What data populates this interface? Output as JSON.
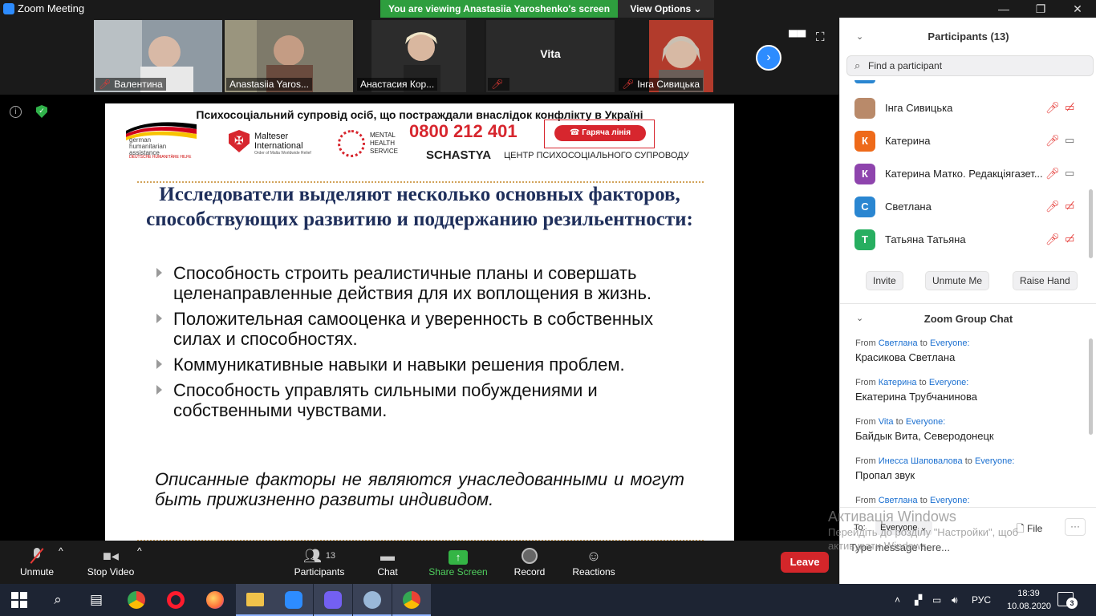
{
  "window": {
    "title": "Zoom Meeting",
    "viewing_banner": "You are viewing Anastasiia Yaroshenko's screen",
    "view_options": "View Options"
  },
  "video_strip": {
    "tiles": [
      {
        "name": "Валентина",
        "muted": true
      },
      {
        "name": "Anastasiia Yaros...",
        "muted": false
      },
      {
        "name": "Анастасия Кор...",
        "muted": false
      },
      {
        "name": "Vita",
        "muted": true
      },
      {
        "name": "Інга Сивицька",
        "muted": true
      }
    ]
  },
  "slide": {
    "header": "Психосоціальний супровід осіб, що постраждали внаслідок конфлікту в Україні",
    "logo_german": "german humanitarian assistance",
    "logo_german_sub": "DEUTSCHE HUMANITÄRE HILFE",
    "logo_malteser": "Malteser International",
    "logo_malteser_sub": "Order of Malta Worldwide Relief",
    "logo_mhs": "MENTAL HEALTH SERVICE",
    "hotline_number": "0800 212 401",
    "hotline_label": "Гаряча лінія",
    "schastya": "SCHASTYA",
    "center_label": "ЦЕНТР  ПСИХОСОЦІАЛЬНОГО СУПРОВОДУ",
    "title": "Исследователи выделяют несколько основных факторов, способствующих развитию и поддержанию резильентности:",
    "bullets": [
      "Способность строить реалистичные планы и совершать целенаправленные действия для их воплощения в жизнь.",
      "Положительная самооценка и уверенность в собственных силах и способностях.",
      "Коммуникативные навыки и навыки решения проблем.",
      "Способность управлять сильными побуждениями и собственными чувствами."
    ],
    "note": "Описанные факторы не являются унаследованными и могут быть прижизненно развиты индивидом."
  },
  "toolbar": {
    "unmute": "Unmute",
    "stop_video": "Stop Video",
    "participants": "Participants",
    "participants_count": "13",
    "chat": "Chat",
    "share_screen": "Share Screen",
    "record": "Record",
    "reactions": "Reactions",
    "leave": "Leave"
  },
  "participants_panel": {
    "title": "Participants (13)",
    "search_placeholder": "Find a participant",
    "participants": [
      {
        "name": "Інга Сивицька",
        "initial": "",
        "color": "#b98a6a",
        "mic_muted": true,
        "video_off": true
      },
      {
        "name": "Катерина",
        "initial": "К",
        "color": "#ee6a1a",
        "mic_muted": true,
        "video_off": false
      },
      {
        "name": "Катерина Матко. Редакціягазет...",
        "initial": "К",
        "color": "#8e44ad",
        "mic_muted": true,
        "video_off": false
      },
      {
        "name": "Светлана",
        "initial": "С",
        "color": "#2a86d1",
        "mic_muted": true,
        "video_off": true
      },
      {
        "name": "Татьяна Татьяна",
        "initial": "Т",
        "color": "#27ae60",
        "mic_muted": true,
        "video_off": true
      }
    ],
    "invite": "Invite",
    "unmute_me": "Unmute Me",
    "raise_hand": "Raise Hand"
  },
  "chat_panel": {
    "title": "Zoom Group Chat",
    "from": "From",
    "to": "to",
    "everyone": "Everyone:",
    "messages": [
      {
        "sender": "Светлана",
        "text": "Красикова Светлана"
      },
      {
        "sender": "Катерина",
        "text": "Екатерина Трубчанинова"
      },
      {
        "sender": "Vita",
        "text": "Байдык Вита, Северодонецк"
      },
      {
        "sender": "Инесса Шаповалова",
        "text": "Пропал звук"
      },
      {
        "sender": "Светлана",
        "text": ""
      }
    ],
    "to_label": "To:",
    "recipient": "Everyone",
    "file": "File",
    "more": "···",
    "message_placeholder": "Type message here..."
  },
  "watermark": {
    "line1": "Активація Windows",
    "line2": "Перейдіть до розділу \"Настройки\", щоб активувати Windows."
  },
  "taskbar": {
    "language": "РУС",
    "time": "18:39",
    "date": "10.08.2020",
    "notifications": "3"
  },
  "icons": [
    "zoom-icon",
    "minimize-icon",
    "restore-icon",
    "close-icon",
    "gallery-view-icon",
    "fullscreen-icon",
    "next-icon",
    "info-icon",
    "shield-icon",
    "microphone-off-icon",
    "video-icon",
    "participants-icon",
    "chat-icon",
    "share-screen-icon",
    "record-icon",
    "reactions-icon",
    "search-icon",
    "chevron-down-icon",
    "windows-icon",
    "taskbar-search-icon",
    "task-view-icon",
    "chrome-icon",
    "opera-icon",
    "firefox-icon",
    "explorer-icon",
    "zoom-app-icon",
    "viber-icon",
    "paint-icon",
    "chrome-app-icon",
    "tray-up-icon",
    "network-icon",
    "volume-icon",
    "notification-icon"
  ],
  "colors": {
    "zoom_blue": "#2d8cff",
    "share_green": "#4fce5d",
    "banner_green": "#2e9e3e",
    "leave_red": "#d3262a",
    "muted_red": "#e53935",
    "slide_title": "#1f2f5b",
    "hotline_red": "#d7262e"
  }
}
